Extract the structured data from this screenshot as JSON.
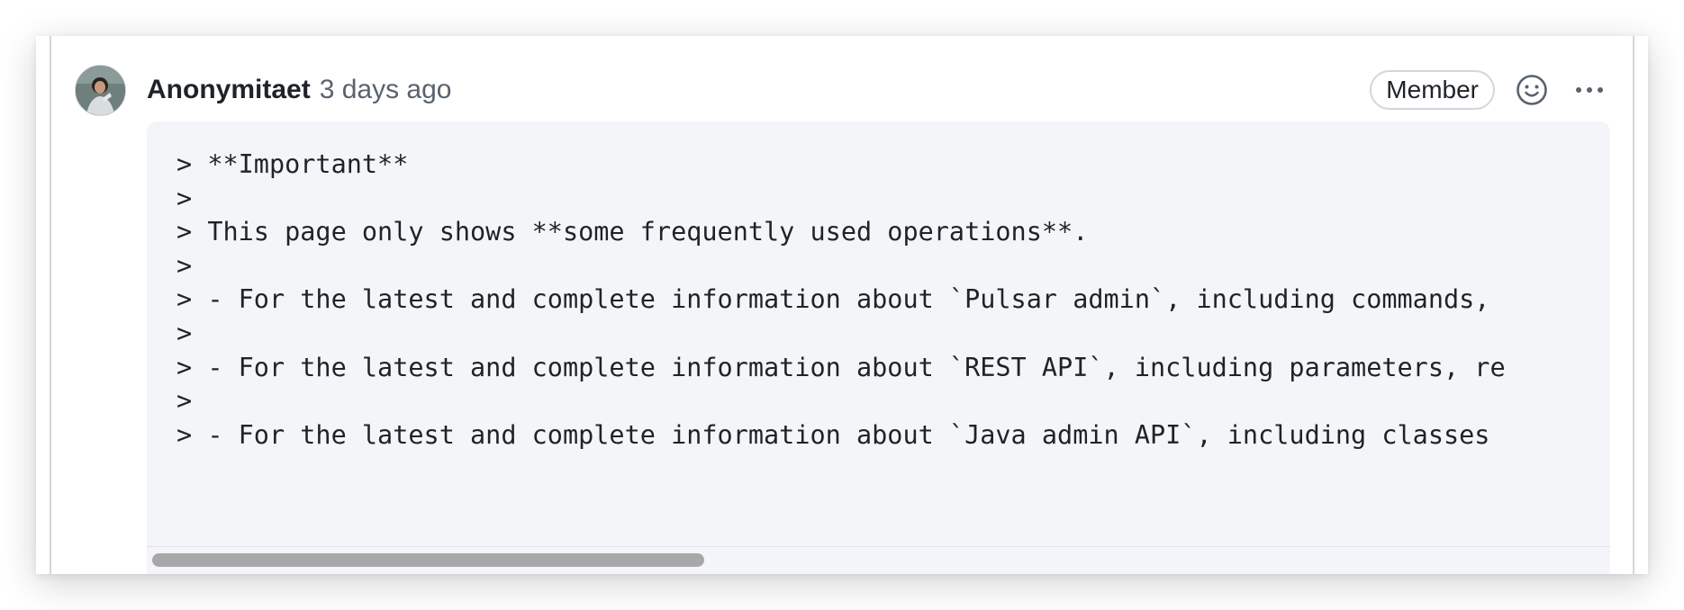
{
  "comment": {
    "author": "Anonymitaet",
    "timestamp": "3 days ago",
    "badge": "Member",
    "avatar_icon": "user-avatar",
    "reaction_icon": "smiley-icon",
    "menu_icon": "kebab-horizontal-icon"
  },
  "code_block": {
    "lines": [
      "> **Important**",
      ">",
      "> This page only shows **some frequently used operations**.",
      ">",
      "> - For the latest and complete information about `Pulsar admin`, including commands,",
      ">",
      "> - For the latest and complete information about `REST API`, including parameters, re",
      ">",
      "> - For the latest and complete information about `Java admin API`, including classes"
    ],
    "scroll": {
      "position": 0,
      "visible_fraction": 0.38
    }
  },
  "colors": {
    "text": "#1f2328",
    "muted": "#59636e",
    "code_bg": "#f4f5f9",
    "border": "#d0d7de"
  }
}
